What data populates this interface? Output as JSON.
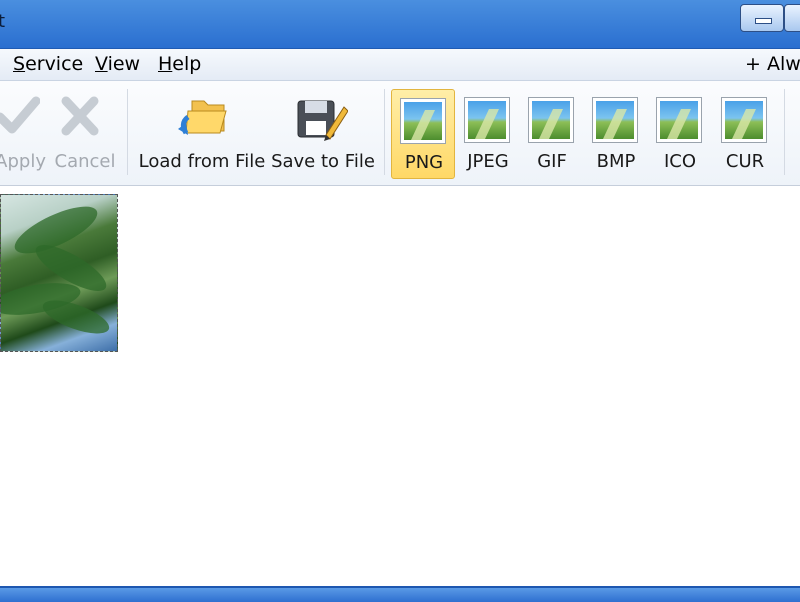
{
  "window": {
    "title_fragment": "t"
  },
  "menu": {
    "items": [
      {
        "label": "Service",
        "underline": "S",
        "rest": "ervice"
      },
      {
        "label": "View",
        "underline": "V",
        "rest": "iew"
      },
      {
        "label": "Help",
        "underline": "H",
        "rest": "elp"
      }
    ],
    "right_label": "+ Alwa"
  },
  "toolbar": {
    "apply_label": "Apply",
    "cancel_label": "Cancel",
    "load_label": "Load from File",
    "save_label": "Save to File",
    "formats": [
      {
        "label": "PNG",
        "active": true
      },
      {
        "label": "JPEG",
        "active": false
      },
      {
        "label": "GIF",
        "active": false
      },
      {
        "label": "BMP",
        "active": false
      },
      {
        "label": "ICO",
        "active": false
      },
      {
        "label": "CUR",
        "active": false
      }
    ]
  },
  "colors": {
    "titlebar": "#2a6fd0",
    "active_format": "#ffd866",
    "disabled_text": "#a4a9b0"
  }
}
